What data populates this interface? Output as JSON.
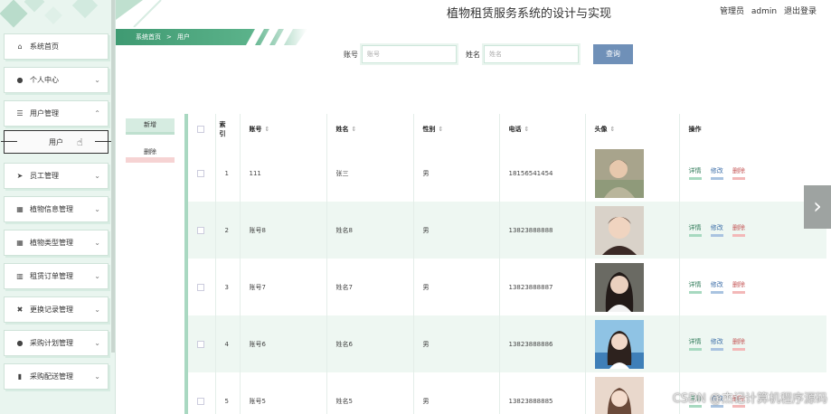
{
  "header": {
    "site_title": "植物租赁服务系统的设计与实现",
    "role": "管理员",
    "user": "admin",
    "logout": "退出登录"
  },
  "breadcrumb": {
    "home": "系统首页",
    "sep": ">",
    "current": "用户"
  },
  "sidebar": {
    "items": [
      {
        "label": "系统首页",
        "icon": "home-icon",
        "glyph": "⌂"
      },
      {
        "label": "个人中心",
        "icon": "person-icon",
        "glyph": "●"
      },
      {
        "label": "用户管理",
        "icon": "list-icon",
        "glyph": "☰"
      },
      {
        "label": "员工管理",
        "icon": "send-icon",
        "glyph": "➤"
      },
      {
        "label": "植物信息管理",
        "icon": "grid-icon",
        "glyph": "▦"
      },
      {
        "label": "植物类型管理",
        "icon": "grid-icon",
        "glyph": "▦"
      },
      {
        "label": "租赁订单管理",
        "icon": "chart-icon",
        "glyph": "▥"
      },
      {
        "label": "更换记录管理",
        "icon": "swap-icon",
        "glyph": "✖"
      },
      {
        "label": "采购计划管理",
        "icon": "person-icon",
        "glyph": "●"
      },
      {
        "label": "采购配送管理",
        "icon": "bar-chart-icon",
        "glyph": "▮"
      }
    ],
    "sub_item": "用户"
  },
  "search": {
    "account_label": "账号",
    "account_placeholder": "账号",
    "name_label": "姓名",
    "name_placeholder": "姓名",
    "button": "查询"
  },
  "actions": {
    "add": "新增",
    "delete": "删除"
  },
  "table": {
    "columns": [
      "索引",
      "账号",
      "姓名",
      "性别",
      "电话",
      "头像",
      "操作"
    ],
    "index_col": "索\n引",
    "sort_glyph": "⇕",
    "ops": {
      "detail": "详情",
      "edit": "修改",
      "delete": "删除"
    },
    "rows": [
      {
        "index": "1",
        "account": "111",
        "name": "张三",
        "gender": "男",
        "phone": "18156541454"
      },
      {
        "index": "2",
        "account": "账号8",
        "name": "姓名8",
        "gender": "男",
        "phone": "13823888888"
      },
      {
        "index": "3",
        "account": "账号7",
        "name": "姓名7",
        "gender": "男",
        "phone": "13823888887"
      },
      {
        "index": "4",
        "account": "账号6",
        "name": "姓名6",
        "gender": "男",
        "phone": "13823888886"
      },
      {
        "index": "5",
        "account": "账号5",
        "name": "姓名5",
        "gender": "男",
        "phone": "13823888885"
      }
    ]
  },
  "watermark": "CSDN @杰记计算机程序源码",
  "colors": {
    "accent": "#3f9a72",
    "sidebar_bg": "#e9f5ef",
    "search_button": "#6f90b8"
  }
}
